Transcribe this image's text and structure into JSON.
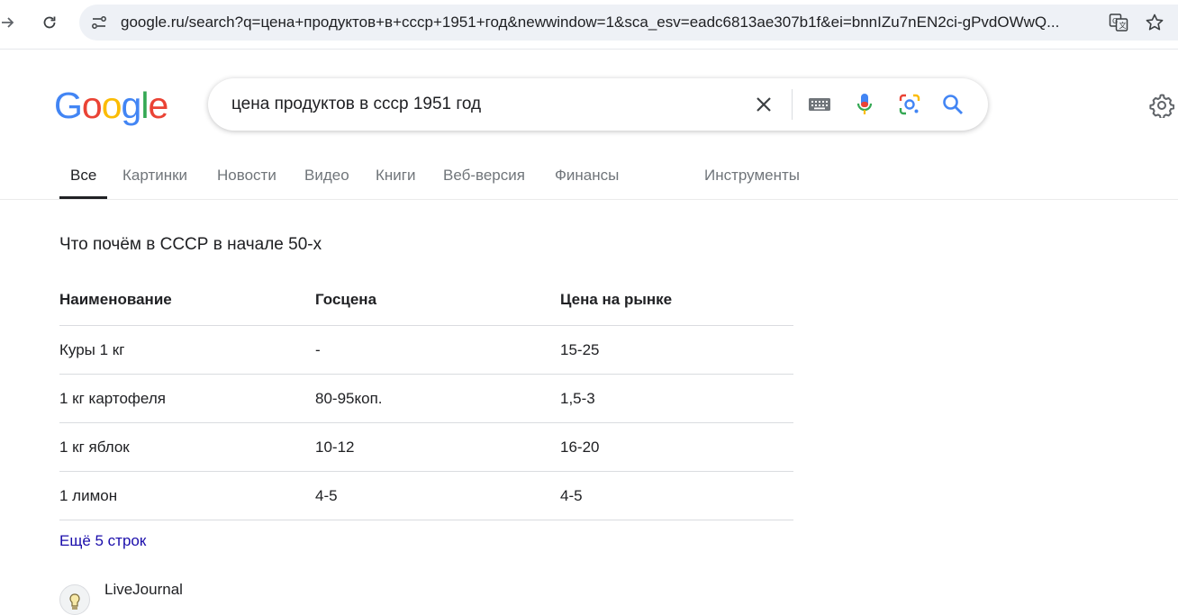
{
  "browser": {
    "url": "google.ru/search?q=цена+продуктов+в+ссср+1951+год&newwindow=1&sca_esv=eadc6813ae307b1f&ei=bnnIZu7nEN2ci-gPvdOWwQ..."
  },
  "search": {
    "query": "цена продуктов в ссср 1951 год",
    "logo": "Google"
  },
  "tabs": [
    {
      "label": "Все"
    },
    {
      "label": "Картинки"
    },
    {
      "label": "Новости"
    },
    {
      "label": "Видео"
    },
    {
      "label": "Книги"
    },
    {
      "label": "Веб-версия"
    },
    {
      "label": "Финансы"
    }
  ],
  "tools_label": "Инструменты",
  "snippet": {
    "title": "Что почём в СССР в начале 50-х",
    "headers": [
      "Наименование",
      "Госцена",
      "Цена на рынке"
    ],
    "rows": [
      [
        "Куры 1 кг",
        "-",
        "15-25"
      ],
      [
        "1 кг картофеля",
        "80-95коп.",
        "1,5-3"
      ],
      [
        "1 кг яблок",
        "10-12",
        "16-20"
      ],
      [
        "1 лимон",
        "4-5",
        "4-5"
      ]
    ],
    "more_label": "Ещё 5 строк",
    "source_name": "LiveJournal"
  },
  "colors": {
    "link": "#1a0dab",
    "google_blue": "#4285f4",
    "google_red": "#ea4335",
    "google_yellow": "#fbbc05",
    "google_green": "#34a853"
  }
}
